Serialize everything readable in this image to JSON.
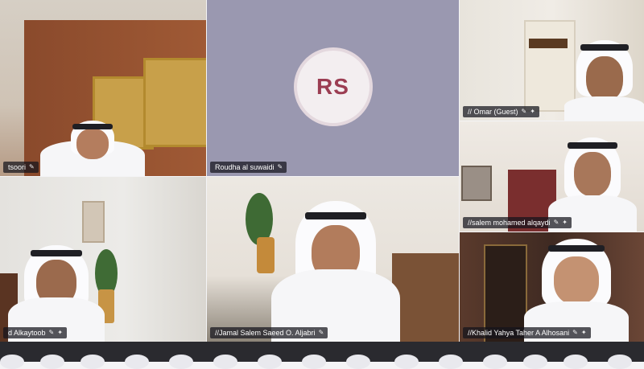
{
  "participants": {
    "p1": {
      "name": "tsoori"
    },
    "p2": {
      "name": "Roudha al suwaidi",
      "initials": "RS"
    },
    "p3": {
      "name": "‏// Omar (Guest)"
    },
    "p4": {
      "name": "d Alkaytoob"
    },
    "p5": {
      "name": "//Jamal Salem Saeed O. Aljabri"
    },
    "p6": {
      "name": "//salem mohamed alqaydi"
    },
    "p7": {
      "name": "//Khalid Yahya Taher A Alhosani"
    }
  },
  "colors": {
    "avatar_initials": "#9b3d52",
    "name_label_bg": "#1a1a22"
  },
  "icons": [
    "mic-muted-icon",
    "pin-icon"
  ]
}
